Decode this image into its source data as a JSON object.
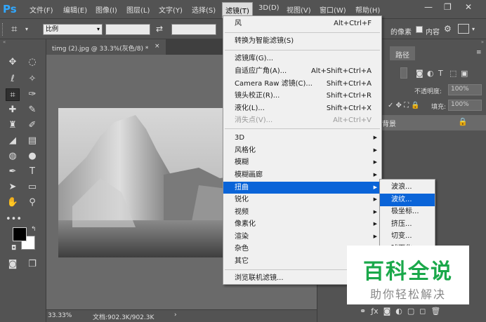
{
  "app": {
    "logo": "Ps"
  },
  "menubar": {
    "items": [
      "文件(F)",
      "编辑(E)",
      "图像(I)",
      "图层(L)",
      "文字(Y)",
      "选择(S)",
      "滤镜(T)",
      "3D(D)",
      "视图(V)",
      "窗口(W)",
      "帮助(H)"
    ],
    "window_controls": [
      "—",
      "❐",
      "✕"
    ]
  },
  "options": {
    "ratio_label": "比例",
    "pixel_label": "的像素",
    "content_label": "内容"
  },
  "document": {
    "tab_title": "timg (2).jpg @ 33.3%(灰色/8) *",
    "tab_close": "×"
  },
  "status": {
    "zoom": "33.33%",
    "doc_info": "文档:902.3K/902.3K",
    "arrow": "›"
  },
  "panels": {
    "tab_paths": "路径",
    "opacity_label": "不透明度:",
    "opacity_value": "100%",
    "fill_label": "填充:",
    "fill_value": "100%",
    "layer_name": "背景"
  },
  "filter_menu": {
    "items": [
      {
        "label": "风",
        "shortcut": "Alt+Ctrl+F"
      },
      {
        "label": "转换为智能滤镜(S)",
        "shortcut": ""
      },
      {
        "label": "滤镜库(G)...",
        "shortcut": ""
      },
      {
        "label": "自适应广角(A)...",
        "shortcut": "Alt+Shift+Ctrl+A"
      },
      {
        "label": "Camera Raw 滤镜(C)...",
        "shortcut": "Shift+Ctrl+A"
      },
      {
        "label": "镜头校正(R)...",
        "shortcut": "Shift+Ctrl+R"
      },
      {
        "label": "液化(L)...",
        "shortcut": "Shift+Ctrl+X"
      },
      {
        "label": "消失点(V)...",
        "shortcut": "Alt+Ctrl+V"
      },
      {
        "label": "3D",
        "shortcut": ""
      },
      {
        "label": "风格化",
        "shortcut": ""
      },
      {
        "label": "模糊",
        "shortcut": ""
      },
      {
        "label": "模糊画廊",
        "shortcut": ""
      },
      {
        "label": "扭曲",
        "shortcut": ""
      },
      {
        "label": "锐化",
        "shortcut": ""
      },
      {
        "label": "视频",
        "shortcut": ""
      },
      {
        "label": "像素化",
        "shortcut": ""
      },
      {
        "label": "渲染",
        "shortcut": ""
      },
      {
        "label": "杂色",
        "shortcut": ""
      },
      {
        "label": "其它",
        "shortcut": ""
      },
      {
        "label": "浏览联机滤镜...",
        "shortcut": ""
      }
    ]
  },
  "distort_submenu": {
    "items": [
      "波浪...",
      "波纹...",
      "极坐标...",
      "挤压...",
      "切变...",
      "球面化..."
    ]
  },
  "watermark": {
    "title": "百科全说",
    "subtitle": "助你轻松解决"
  },
  "colors": {
    "menu_highlight": "#0a64d8",
    "ui_bg": "#535353",
    "watermark_green": "#1aa84a"
  }
}
